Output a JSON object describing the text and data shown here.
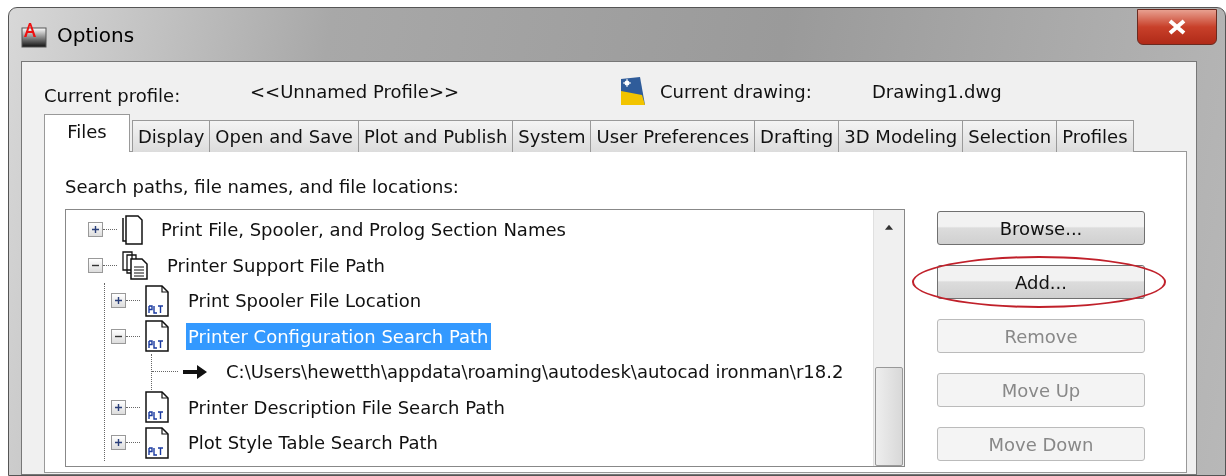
{
  "window": {
    "title": "Options"
  },
  "profile": {
    "label": "Current profile:",
    "value": "<<Unnamed Profile>>",
    "drawing_label": "Current drawing:",
    "drawing_value": "Drawing1.dwg"
  },
  "tabs": [
    {
      "label": "Files",
      "selected": true
    },
    {
      "label": "Display",
      "selected": false
    },
    {
      "label": "Open and Save",
      "selected": false
    },
    {
      "label": "Plot and Publish",
      "selected": false
    },
    {
      "label": "System",
      "selected": false
    },
    {
      "label": "User Preferences",
      "selected": false
    },
    {
      "label": "Drafting",
      "selected": false
    },
    {
      "label": "3D Modeling",
      "selected": false
    },
    {
      "label": "Selection",
      "selected": false
    },
    {
      "label": "Profiles",
      "selected": false
    }
  ],
  "panel": {
    "caption": "Search paths, file names, and file locations:"
  },
  "tree": [
    {
      "label": "Print File, Spooler, and Prolog Section Names",
      "kind": "folder",
      "expanded": false,
      "selected": false
    },
    {
      "label": "Printer Support File Path",
      "kind": "folders",
      "expanded": true,
      "selected": false,
      "children": [
        {
          "label": "Print Spooler File Location",
          "kind": "plt",
          "expanded": false,
          "selected": false
        },
        {
          "label": "Printer Configuration Search Path",
          "kind": "plt",
          "expanded": true,
          "selected": true,
          "children": [
            {
              "label": "C:\\Users\\hewetth\\appdata\\roaming\\autodesk\\autocad ironman\\r18.2",
              "kind": "path",
              "selected": false
            }
          ]
        },
        {
          "label": "Printer Description File Search Path",
          "kind": "plt",
          "expanded": false,
          "selected": false
        },
        {
          "label": "Plot Style Table Search Path",
          "kind": "plt",
          "expanded": false,
          "selected": false
        }
      ]
    }
  ],
  "buttons": [
    {
      "label": "Browse...",
      "disabled": false,
      "annotated": false
    },
    {
      "label": "Add...",
      "disabled": false,
      "annotated": true
    },
    {
      "label": "Remove",
      "disabled": true,
      "annotated": false
    },
    {
      "label": "Move Up",
      "disabled": true,
      "annotated": false
    },
    {
      "label": "Move Down",
      "disabled": true,
      "annotated": false
    }
  ]
}
